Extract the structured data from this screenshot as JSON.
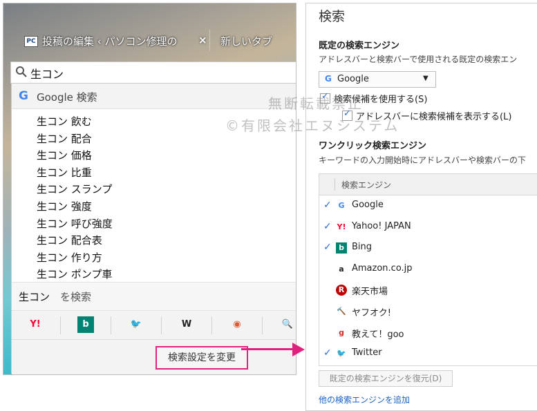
{
  "browser": {
    "tabs": [
      {
        "favicon": "PC",
        "title": "投稿の編集 ‹ パソコン修理の",
        "close": "×"
      },
      {
        "title": "新しいタブ"
      }
    ],
    "address_bar": {
      "value": "生コン",
      "icon": "search-icon"
    },
    "dropdown": {
      "engine_row": {
        "logo": "G",
        "label": "Google 検索"
      },
      "suggestions": [
        "生コン 飲む",
        "生コン 配合",
        "生コン 価格",
        "生コン 比重",
        "生コン スランプ",
        "生コン 強度",
        "生コン 呼び強度",
        "生コン 配合表",
        "生コン 作り方",
        "生コン ポンプ車"
      ],
      "search_for": {
        "query": "生コン",
        "suffix": "を検索"
      },
      "one_click_engines": [
        {
          "icon": "yahoo-icon",
          "glyph": "Y!",
          "color": "#ff0033"
        },
        {
          "icon": "bing-icon",
          "glyph": "b",
          "color": "#008373"
        },
        {
          "icon": "twitter-icon",
          "glyph": "🐦",
          "color": "#1da1f2"
        },
        {
          "icon": "wikipedia-icon",
          "glyph": "W",
          "color": "#222222"
        },
        {
          "icon": "duckduckgo-icon",
          "glyph": "◉",
          "color": "#de5833"
        },
        {
          "icon": "search-engine-icon",
          "glyph": "🔍",
          "color": "#666666"
        }
      ],
      "change_settings_label": "検索設定を変更"
    }
  },
  "settings": {
    "title": "検索",
    "default_engine": {
      "heading": "既定の検索エンジン",
      "description": "アドレスバーと検索バーで使用される既定の検索エン",
      "selected": "Google",
      "selected_logo": "G"
    },
    "checkboxes": [
      {
        "label": "検索候補を使用する(S)",
        "checked": true
      },
      {
        "label": "アドレスバーに検索候補を表示する(L)",
        "checked": true
      }
    ],
    "one_click": {
      "heading": "ワンクリック検索エンジン",
      "description": "キーワードの入力開始時にアドレスバーや検索バーの下",
      "column_header": "検索エンジン",
      "engines": [
        {
          "name": "Google",
          "checked": true,
          "glyph": "G",
          "color": "#4285f4"
        },
        {
          "name": "Yahoo! JAPAN",
          "checked": true,
          "glyph": "Y!",
          "color": "#ff0033"
        },
        {
          "name": "Bing",
          "checked": true,
          "glyph": "b",
          "color": "#008373"
        },
        {
          "name": "Amazon.co.jp",
          "checked": false,
          "glyph": "a",
          "color": "#222222"
        },
        {
          "name": "楽天市場",
          "checked": false,
          "glyph": "R",
          "color": "#bf0000"
        },
        {
          "name": "ヤフオク!",
          "checked": false,
          "glyph": "🔨",
          "color": "#e08a00"
        },
        {
          "name": "教えて！goo",
          "checked": false,
          "glyph": "g",
          "color": "#d12c2c"
        },
        {
          "name": "Twitter",
          "checked": true,
          "glyph": "🐦",
          "color": "#1da1f2"
        }
      ]
    },
    "restore_button": "既定の検索エンジンを復元(D)",
    "add_more_link": "他の検索エンジンを追加"
  },
  "watermark": {
    "line1": "無断転載禁止",
    "line2": "©有限会社エヌシステム"
  },
  "accent_color": "#e0227e"
}
